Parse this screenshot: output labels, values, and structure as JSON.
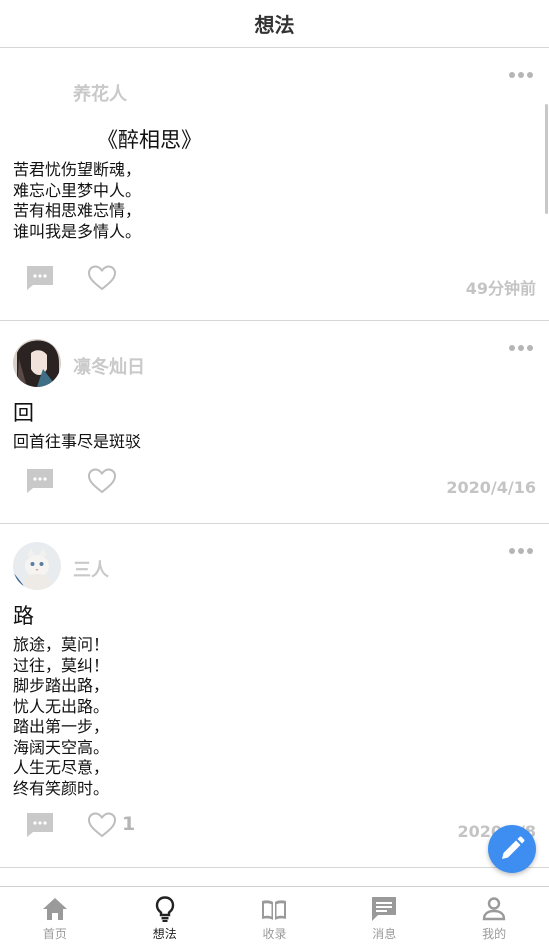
{
  "header": {
    "title": "想法"
  },
  "posts": [
    {
      "author": "养花人",
      "title": "《醉相思》",
      "body": "苦君忧伤望断魂，\n难忘心里梦中人。\n苦有相思难忘情，\n谁叫我是多情人。",
      "time": "49分钟前",
      "likes": ""
    },
    {
      "author": "凛冬灿日",
      "title": "回",
      "body": "回首往事尽是斑驳",
      "time": "2020/4/16",
      "likes": ""
    },
    {
      "author": "三人",
      "title": "路",
      "body": "旅途，莫问！\n过往，莫纠！\n脚步踏出路，\n忧人无出路。\n踏出第一步，\n海阔天空高。\n人生无尽意，\n终有笑颜时。",
      "time": "2020/4/8",
      "likes": "1"
    }
  ],
  "tabs": [
    {
      "label": "首页",
      "icon": "home-icon"
    },
    {
      "label": "想法",
      "icon": "lightbulb-icon"
    },
    {
      "label": "收录",
      "icon": "book-icon"
    },
    {
      "label": "消息",
      "icon": "message-icon"
    },
    {
      "label": "我的",
      "icon": "person-icon"
    }
  ],
  "active_tab": "想法",
  "colors": {
    "fab": "#3d8ef0",
    "muted": "#b5b5b5"
  },
  "fab_icon": "edit-pencil-icon"
}
